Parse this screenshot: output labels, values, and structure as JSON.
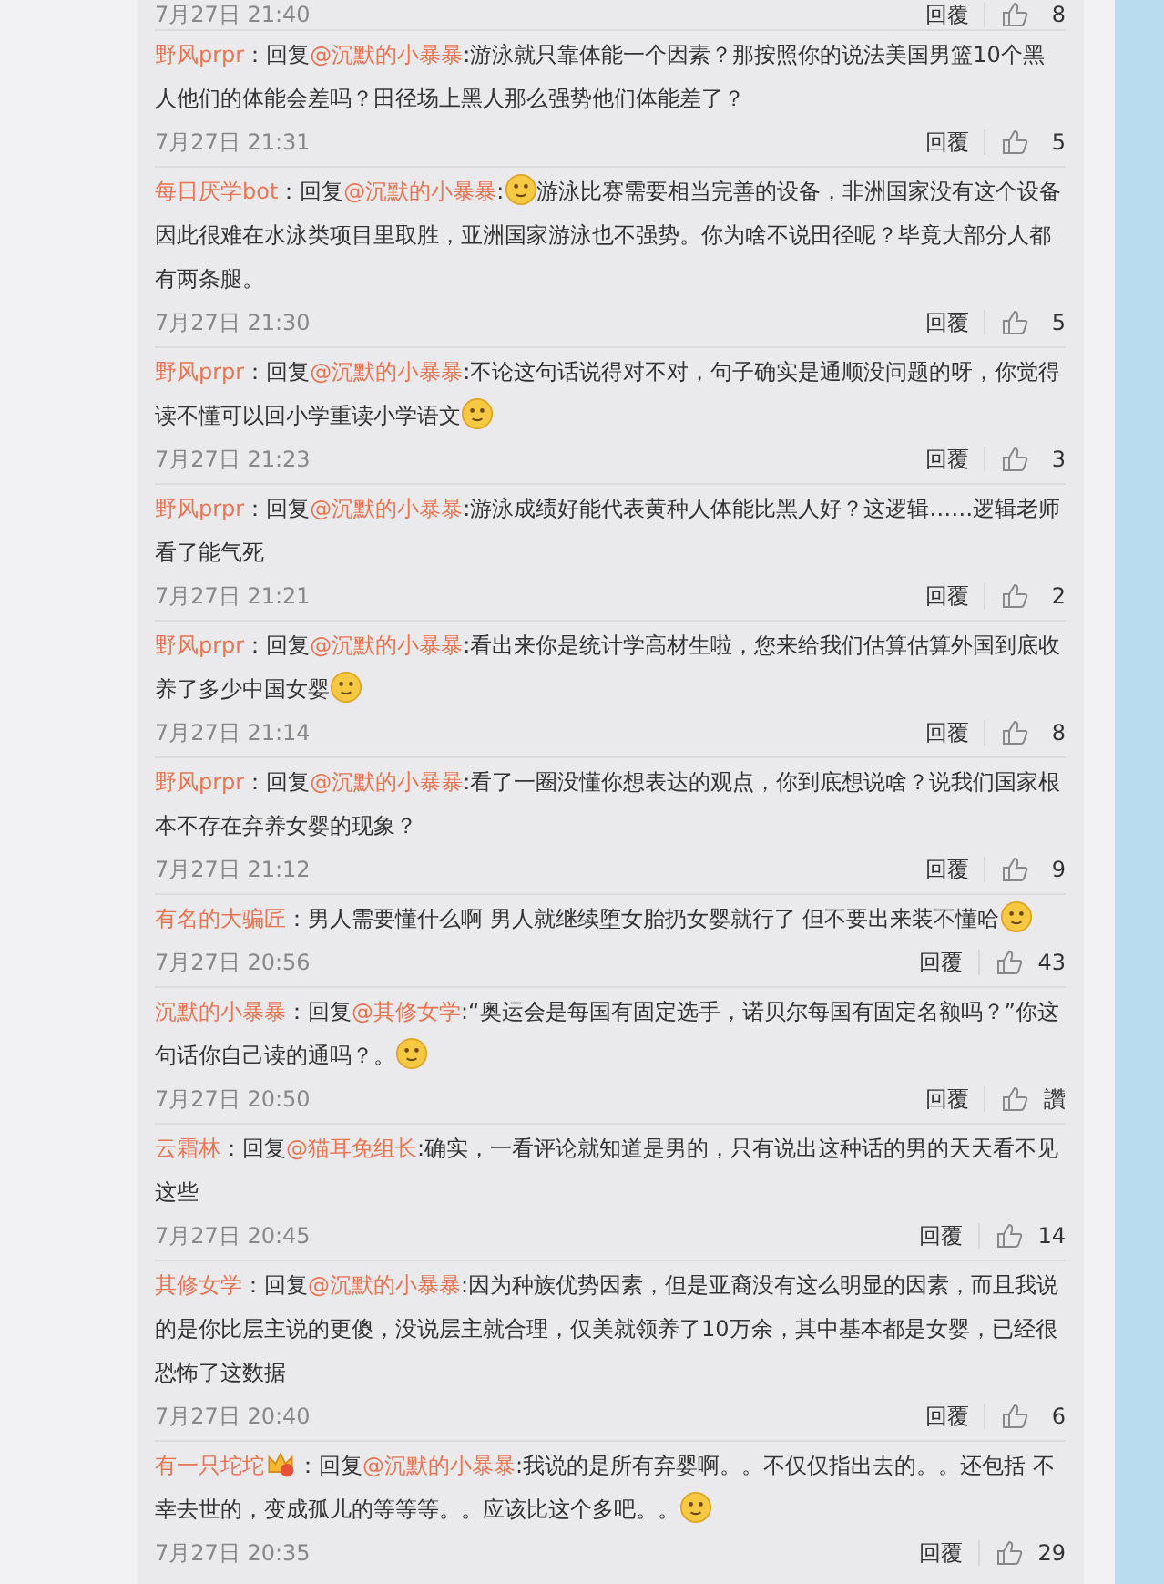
{
  "comments": [
    {
      "date": "7月27日 21:40",
      "reply": "回覆",
      "likes": "8"
    },
    {
      "segments": [
        {
          "kind": "author",
          "text": "野风prpr"
        },
        {
          "kind": "text",
          "text": "：回复"
        },
        {
          "kind": "mention",
          "text": "@沉默的小暴暴"
        },
        {
          "kind": "text",
          "text": ":游泳就只靠体能一个因素？那按照你的说法美国男篮10个黑人他们的体能会差吗？田径场上黑人那么强势他们体能差了？"
        }
      ],
      "date": "7月27日 21:31",
      "reply": "回覆",
      "likes": "5"
    },
    {
      "segments": [
        {
          "kind": "author",
          "text": "每日厌学bot"
        },
        {
          "kind": "text",
          "text": "：回复"
        },
        {
          "kind": "mention",
          "text": "@沉默的小暴暴"
        },
        {
          "kind": "text",
          "text": ":"
        },
        {
          "kind": "emoji"
        },
        {
          "kind": "text",
          "text": "游泳比赛需要相当完善的设备，非洲国家没有这个设备因此很难在水泳类项目里取胜，亚洲国家游泳也不强势。你为啥不说田径呢？毕竟大部分人都有两条腿。"
        }
      ],
      "date": "7月27日 21:30",
      "reply": "回覆",
      "likes": "5"
    },
    {
      "segments": [
        {
          "kind": "author",
          "text": "野风prpr"
        },
        {
          "kind": "text",
          "text": "：回复"
        },
        {
          "kind": "mention",
          "text": "@沉默的小暴暴"
        },
        {
          "kind": "text",
          "text": ":不论这句话说得对不对，句子确实是通顺没问题的呀，你觉得读不懂可以回小学重读小学语文"
        },
        {
          "kind": "emoji"
        }
      ],
      "date": "7月27日 21:23",
      "reply": "回覆",
      "likes": "3"
    },
    {
      "segments": [
        {
          "kind": "author",
          "text": "野风prpr"
        },
        {
          "kind": "text",
          "text": "：回复"
        },
        {
          "kind": "mention",
          "text": "@沉默的小暴暴"
        },
        {
          "kind": "text",
          "text": ":游泳成绩好能代表黄种人体能比黑人好？这逻辑……逻辑老师看了能气死"
        }
      ],
      "date": "7月27日 21:21",
      "reply": "回覆",
      "likes": "2"
    },
    {
      "segments": [
        {
          "kind": "author",
          "text": "野风prpr"
        },
        {
          "kind": "text",
          "text": "：回复"
        },
        {
          "kind": "mention",
          "text": "@沉默的小暴暴"
        },
        {
          "kind": "text",
          "text": ":看出来你是统计学高材生啦，您来给我们估算估算外国到底收养了多少中国女婴"
        },
        {
          "kind": "emoji"
        }
      ],
      "date": "7月27日 21:14",
      "reply": "回覆",
      "likes": "8"
    },
    {
      "segments": [
        {
          "kind": "author",
          "text": "野风prpr"
        },
        {
          "kind": "text",
          "text": "：回复"
        },
        {
          "kind": "mention",
          "text": "@沉默的小暴暴"
        },
        {
          "kind": "text",
          "text": ":看了一圈没懂你想表达的观点，你到底想说啥？说我们国家根本不存在弃养女婴的现象？"
        }
      ],
      "date": "7月27日 21:12",
      "reply": "回覆",
      "likes": "9"
    },
    {
      "segments": [
        {
          "kind": "author",
          "text": "有名的大骗匠"
        },
        {
          "kind": "text",
          "text": "：男人需要懂什么啊 男人就继续堕女胎扔女婴就行了 但不要出来装不懂哈"
        },
        {
          "kind": "emoji"
        }
      ],
      "date": "7月27日 20:56",
      "reply": "回覆",
      "likes": "43"
    },
    {
      "segments": [
        {
          "kind": "author",
          "text": "沉默的小暴暴"
        },
        {
          "kind": "text",
          "text": "：回复"
        },
        {
          "kind": "mention",
          "text": "@其修女学"
        },
        {
          "kind": "text",
          "text": ":“奥运会是每国有固定选手，诺贝尔每国有固定名额吗？”你这句话你自己读的通吗？。"
        },
        {
          "kind": "emoji"
        }
      ],
      "date": "7月27日 20:50",
      "reply": "回覆",
      "likes": "讚"
    },
    {
      "segments": [
        {
          "kind": "author",
          "text": "云霜林"
        },
        {
          "kind": "text",
          "text": "：回复"
        },
        {
          "kind": "mention",
          "text": "@猫耳免组长"
        },
        {
          "kind": "text",
          "text": ":确实，一看评论就知道是男的，只有说出这种话的男的天天看不见这些"
        }
      ],
      "date": "7月27日 20:45",
      "reply": "回覆",
      "likes": "14"
    },
    {
      "segments": [
        {
          "kind": "author",
          "text": "其修女学"
        },
        {
          "kind": "text",
          "text": "：回复"
        },
        {
          "kind": "mention",
          "text": "@沉默的小暴暴"
        },
        {
          "kind": "text",
          "text": ":因为种族优势因素，但是亚裔没有这么明显的因素，而且我说的是你比层主说的更傻，没说层主就合理，仅美就领养了10万余，其中基本都是女婴，已经很恐怖了这数据"
        }
      ],
      "date": "7月27日 20:40",
      "reply": "回覆",
      "likes": "6"
    },
    {
      "segments": [
        {
          "kind": "author",
          "text": "有一只坨坨"
        },
        {
          "kind": "badge"
        },
        {
          "kind": "text",
          "text": "：回复"
        },
        {
          "kind": "mention",
          "text": "@沉默的小暴暴"
        },
        {
          "kind": "text",
          "text": ":我说的是所有弃婴啊。。不仅仅指出去的。。还包括 不幸去世的，变成孤儿的等等等。。应该比这个多吧。。"
        },
        {
          "kind": "emoji"
        }
      ],
      "date": "7月27日 20:35",
      "reply": "回覆",
      "likes": "29"
    }
  ]
}
